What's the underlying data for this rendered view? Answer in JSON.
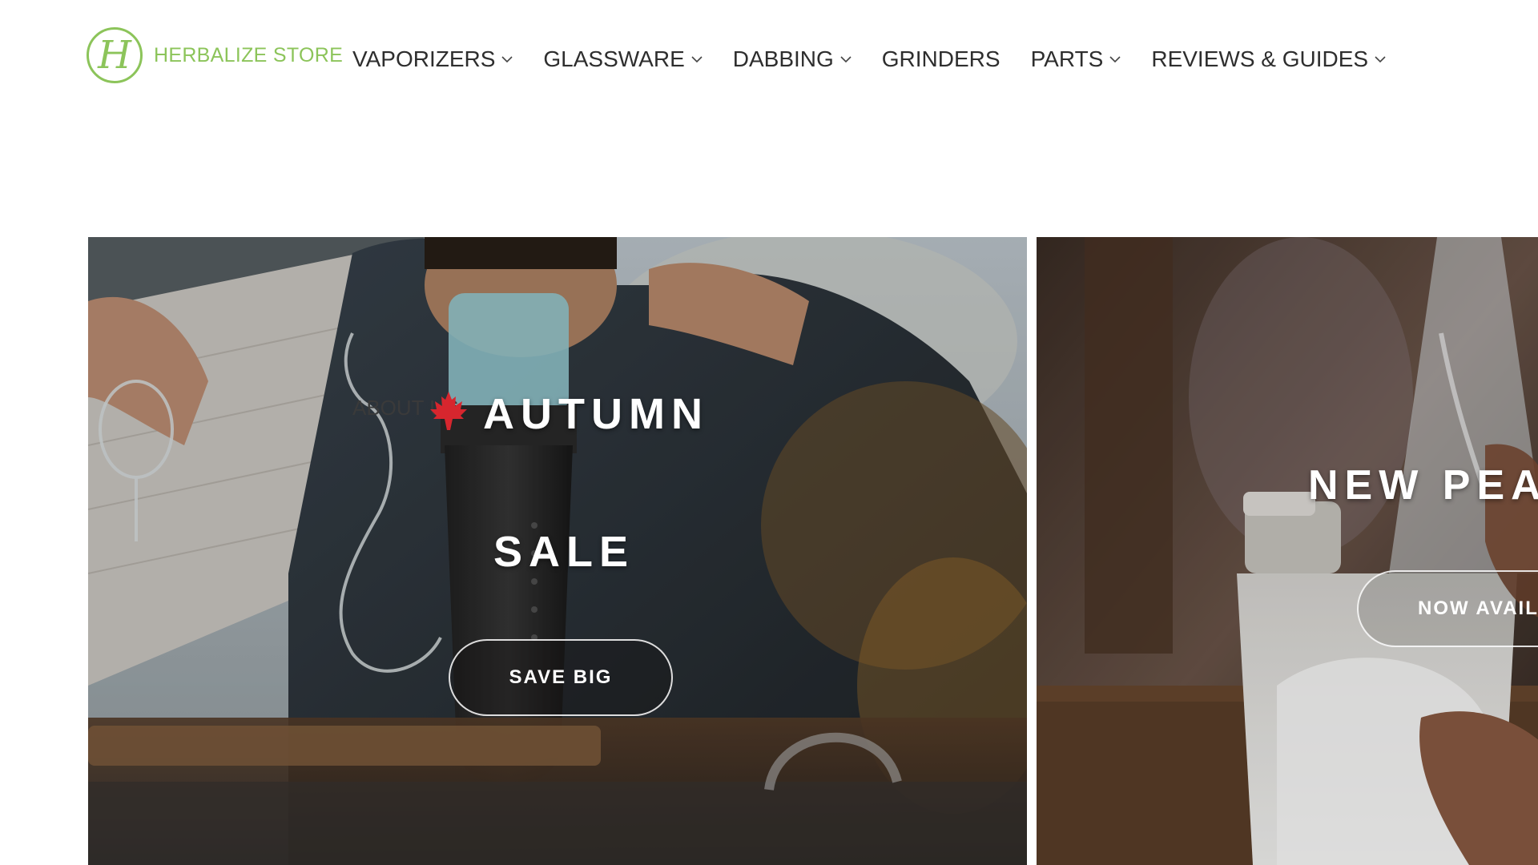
{
  "brand": {
    "logo_letter": "H",
    "name": "HERBALIZE STORE",
    "color": "#8cc45a"
  },
  "nav": [
    {
      "label": "VAPORIZERS",
      "has_dropdown": true
    },
    {
      "label": "GLASSWARE",
      "has_dropdown": true
    },
    {
      "label": "DABBING",
      "has_dropdown": true
    },
    {
      "label": "GRINDERS",
      "has_dropdown": false
    },
    {
      "label": "PARTS",
      "has_dropdown": true
    },
    {
      "label": "REVIEWS & GUIDES",
      "has_dropdown": true
    }
  ],
  "about_link": "ABOUT US",
  "slides": [
    {
      "title_line1": "AUTUMN",
      "title_line2": "SALE",
      "button": "SAVE BIG",
      "icon": "maple-leaf-icon"
    },
    {
      "title": "NEW PEA",
      "button": "NOW AVAIL"
    }
  ]
}
